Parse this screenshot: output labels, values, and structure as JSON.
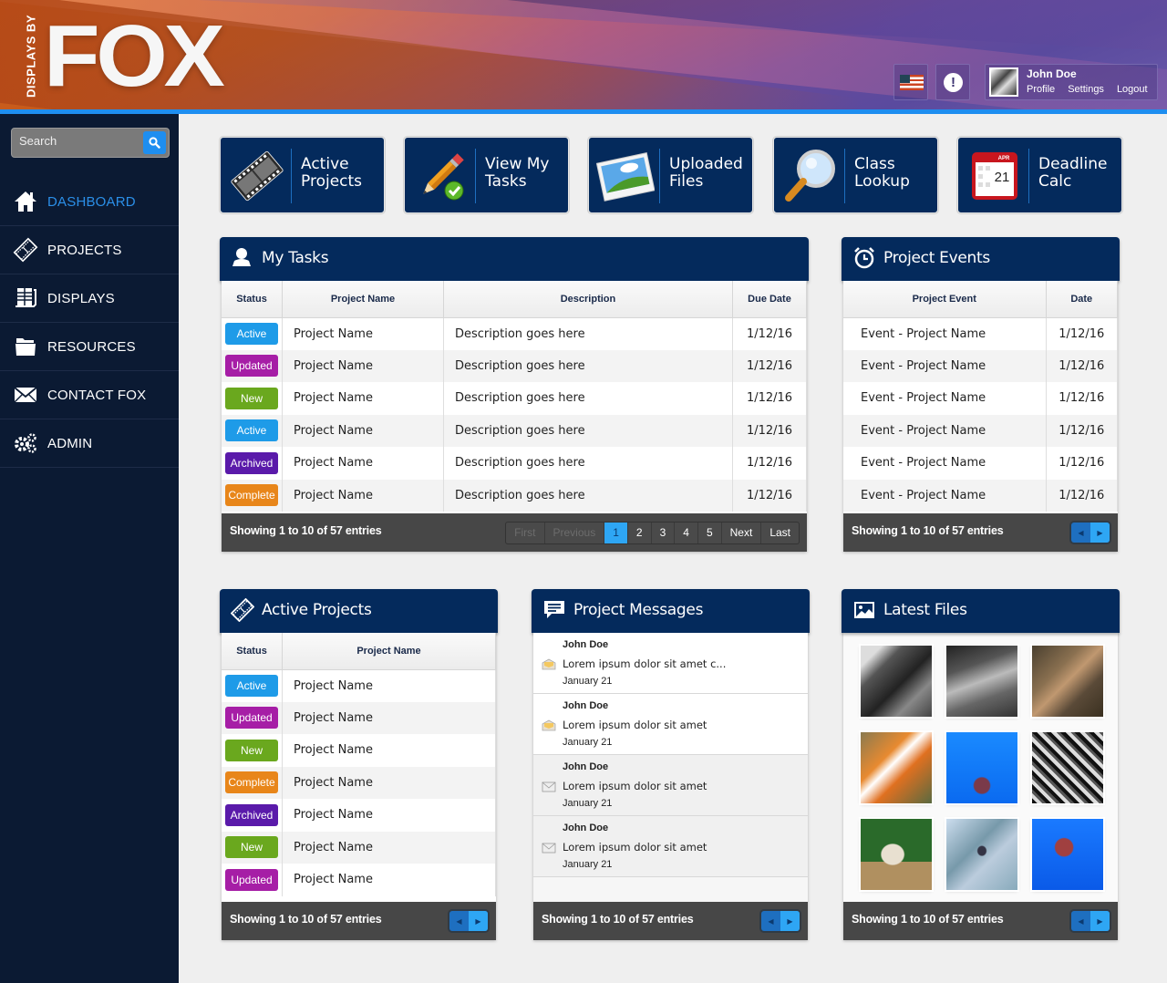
{
  "brand": {
    "small": "DISPLAYS BY",
    "big": "FOX"
  },
  "header": {
    "alert_symbol": "!",
    "user": {
      "name": "John Doe",
      "links": [
        "Profile",
        "Settings",
        "Logout"
      ]
    }
  },
  "sidebar": {
    "search_placeholder": "Search",
    "items": [
      {
        "label": "DASHBOARD",
        "icon": "home-icon",
        "active": true
      },
      {
        "label": "PROJECTS",
        "icon": "film-icon"
      },
      {
        "label": "DISPLAYS",
        "icon": "displays-icon"
      },
      {
        "label": "RESOURCES",
        "icon": "folder-icon"
      },
      {
        "label": "CONTACT FOX",
        "icon": "envelope-icon"
      },
      {
        "label": "ADMIN",
        "icon": "gears-icon"
      }
    ]
  },
  "tiles": [
    {
      "label": "Active Projects",
      "icon": "film-reel-icon"
    },
    {
      "label": "View My Tasks",
      "icon": "pencil-check-icon"
    },
    {
      "label": "Uploaded Files",
      "icon": "picture-icon"
    },
    {
      "label": "Class Lookup",
      "icon": "magnifier-icon"
    },
    {
      "label": "Deadline Calc",
      "icon": "calendar-icon",
      "calendar_month": "APR",
      "calendar_day": "21"
    }
  ],
  "status_colors": {
    "Active": "#1e9be8",
    "Updated": "#a61ea6",
    "New": "#6aa81e",
    "Archived": "#5a1aaa",
    "Complete": "#e8861a"
  },
  "my_tasks": {
    "title": "My Tasks",
    "columns": [
      "Status",
      "Project Name",
      "Description",
      "Due Date"
    ],
    "rows": [
      {
        "status": "Active",
        "project": "Project Name",
        "description": "Description goes here",
        "due": "1/12/16"
      },
      {
        "status": "Updated",
        "project": "Project Name",
        "description": "Description goes here",
        "due": "1/12/16"
      },
      {
        "status": "New",
        "project": "Project Name",
        "description": "Description goes here",
        "due": "1/12/16"
      },
      {
        "status": "Active",
        "project": "Project Name",
        "description": "Description goes here",
        "due": "1/12/16"
      },
      {
        "status": "Archived",
        "project": "Project Name",
        "description": "Description goes here",
        "due": "1/12/16"
      },
      {
        "status": "Complete",
        "project": "Project Name",
        "description": "Description goes here",
        "due": "1/12/16"
      }
    ],
    "footer": "Showing 1 to 10 of 57 entries",
    "pager": {
      "first": "First",
      "previous": "Previous",
      "pages": [
        "1",
        "2",
        "3",
        "4",
        "5"
      ],
      "current": "1",
      "next": "Next",
      "last": "Last"
    }
  },
  "project_events": {
    "title": "Project Events",
    "columns": [
      "Project Event",
      "Date"
    ],
    "rows": [
      {
        "event": "Event - Project Name",
        "date": "1/12/16"
      },
      {
        "event": "Event - Project Name",
        "date": "1/12/16"
      },
      {
        "event": "Event - Project Name",
        "date": "1/12/16"
      },
      {
        "event": "Event - Project Name",
        "date": "1/12/16"
      },
      {
        "event": "Event - Project Name",
        "date": "1/12/16"
      },
      {
        "event": "Event - Project Name",
        "date": "1/12/16"
      }
    ],
    "footer": "Showing 1 to 10 of 57 entries"
  },
  "active_projects": {
    "title": "Active Projects",
    "columns": [
      "Status",
      "Project Name"
    ],
    "rows": [
      {
        "status": "Active",
        "project": "Project Name"
      },
      {
        "status": "Updated",
        "project": "Project Name"
      },
      {
        "status": "New",
        "project": "Project Name"
      },
      {
        "status": "Complete",
        "project": "Project Name"
      },
      {
        "status": "Archived",
        "project": "Project Name"
      },
      {
        "status": "New",
        "project": "Project Name"
      },
      {
        "status": "Updated",
        "project": "Project Name"
      }
    ],
    "footer": "Showing 1 to 10 of 57 entries"
  },
  "project_messages": {
    "title": "Project Messages",
    "items": [
      {
        "author": "John Doe",
        "text": "Lorem ipsum dolor sit amet c...",
        "date": "January 21",
        "unread": true
      },
      {
        "author": "John Doe",
        "text": "Lorem ipsum dolor sit amet",
        "date": "January 21",
        "unread": true
      },
      {
        "author": "John Doe",
        "text": "Lorem ipsum dolor sit amet",
        "date": "January 21",
        "unread": false
      },
      {
        "author": "John Doe",
        "text": "Lorem ipsum dolor sit amet",
        "date": "January 21",
        "unread": false
      }
    ],
    "footer": "Showing 1 to 10 of 57 entries"
  },
  "latest_files": {
    "title": "Latest Files",
    "thumbnails": [
      "cat-bw",
      "bird-on-chain-bw",
      "fox-in-leaves",
      "koi-fish",
      "jellyfish-blue",
      "bw-foliage",
      "white-squirrel",
      "shark-underwater",
      "jellyfish-red"
    ],
    "footer": "Showing 1 to 10 of 57 entries"
  }
}
